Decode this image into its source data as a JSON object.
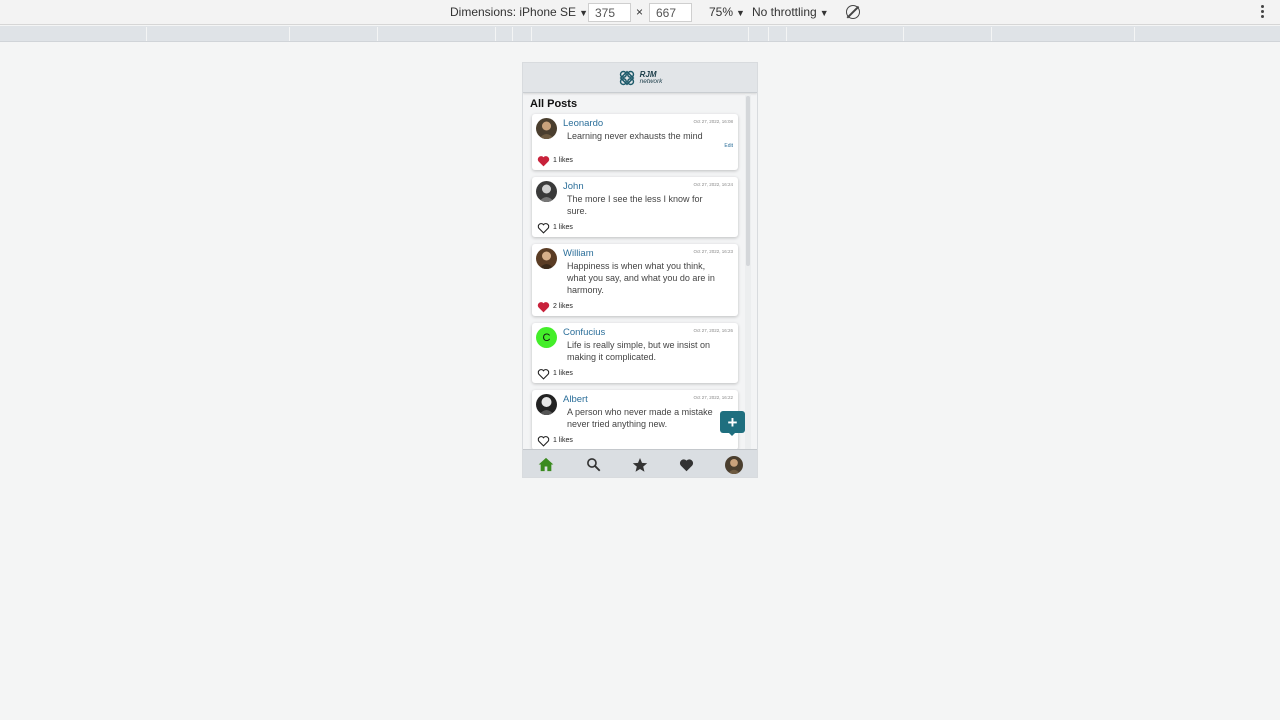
{
  "devtools": {
    "dimensions_label": "Dimensions: iPhone SE",
    "width": "375",
    "times": "×",
    "height": "667",
    "zoom": "75%",
    "throttling": "No throttling"
  },
  "app": {
    "logo_line1": "RJM",
    "logo_line2": "network",
    "feed_title": "All Posts",
    "fab_label": "+"
  },
  "colors": {
    "liked": "#c8223b",
    "link": "#2c6f9a",
    "accent": "#1f6f7f",
    "home_active": "#3a8a1e",
    "confucius_avatar": "#44ee2a"
  },
  "posts": [
    {
      "author": "Leonardo",
      "date": "Oct 27, 2022, 16:08",
      "text": "Learning never exhausts the mind",
      "edit": "Edit",
      "liked": true,
      "likes": "1 likes"
    },
    {
      "author": "John",
      "date": "Oct 27, 2022, 16:24",
      "text": "The more I see the less I know for sure.",
      "edit": "",
      "liked": false,
      "likes": "1 likes"
    },
    {
      "author": "William",
      "date": "Oct 27, 2022, 16:23",
      "text": "Happiness is when what you think, what you say, and what you do are in harmony.",
      "edit": "",
      "liked": true,
      "likes": "2 likes"
    },
    {
      "author": "Confucius",
      "avatar_letter": "C",
      "date": "Oct 27, 2022, 16:26",
      "text": "Life is really simple, but we insist on making it complicated.",
      "edit": "",
      "liked": false,
      "likes": "1 likes"
    },
    {
      "author": "Albert",
      "date": "Oct 27, 2022, 16:22",
      "text": "A person who never made a mistake never tried anything new.",
      "edit": "",
      "liked": false,
      "likes": "1 likes"
    }
  ],
  "nav": [
    "home-icon",
    "search-icon",
    "star-icon",
    "heart-icon",
    "profile-avatar"
  ]
}
